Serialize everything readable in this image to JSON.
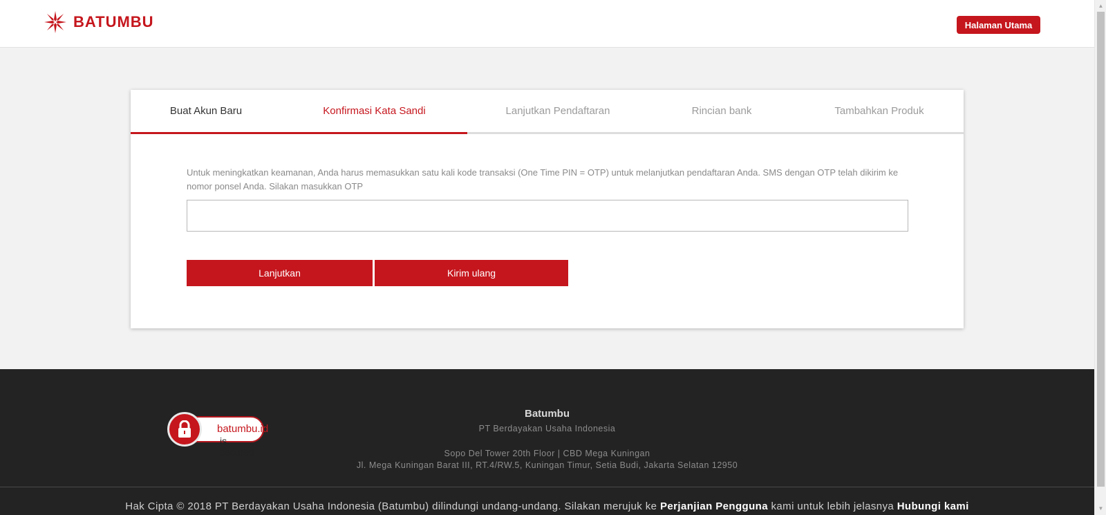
{
  "header": {
    "logo_text": "BATUMBU",
    "home_button": "Halaman Utama"
  },
  "tabs": [
    {
      "label": "Buat Akun Baru",
      "state": "done"
    },
    {
      "label": "Konfirmasi Kata Sandi",
      "state": "active"
    },
    {
      "label": "Lanjutkan Pendaftaran",
      "state": "pending"
    },
    {
      "label": "Rincian bank",
      "state": "pending"
    },
    {
      "label": "Tambahkan Produk",
      "state": "pending"
    }
  ],
  "otp": {
    "instruction": "Untuk meningkatkan keamanan, Anda harus memasukkan satu kali kode transaksi (One Time PIN = OTP) untuk melanjutkan pendaftaran Anda. SMS dengan OTP telah dikirim ke nomor ponsel Anda. Silakan masukkan OTP",
    "value": "",
    "continue_button": "Lanjutkan",
    "resend_button": "Kirim ulang"
  },
  "footer": {
    "badge_line1": "batumbu.id",
    "badge_line2": "is secured",
    "company_name": "Batumbu",
    "company_legal": "PT Berdayakan Usaha Indonesia",
    "address_line1": "Sopo Del Tower 20th Floor  |  CBD Mega Kuningan",
    "address_line2": "Jl. Mega Kuningan Barat III, RT.4/RW.5, Kuningan Timur, Setia Budi, Jakarta Selatan 12950",
    "copyright_text": "Hak Cipta © 2018 PT Berdayakan Usaha Indonesia (Batumbu) dilindungi undang-undang. Silakan merujuk ke ",
    "terms_link": "Perjanjian Pengguna",
    "copyright_mid": " kami untuk lebih jelasnya ",
    "contact_link": "Hubungi kami"
  },
  "colors": {
    "brand": "#c5161d",
    "footer_bg": "#232323",
    "page_bg": "#f2f2f2"
  },
  "icons": {
    "logo": "batumbu-logo-icon",
    "lock": "lock-icon"
  }
}
